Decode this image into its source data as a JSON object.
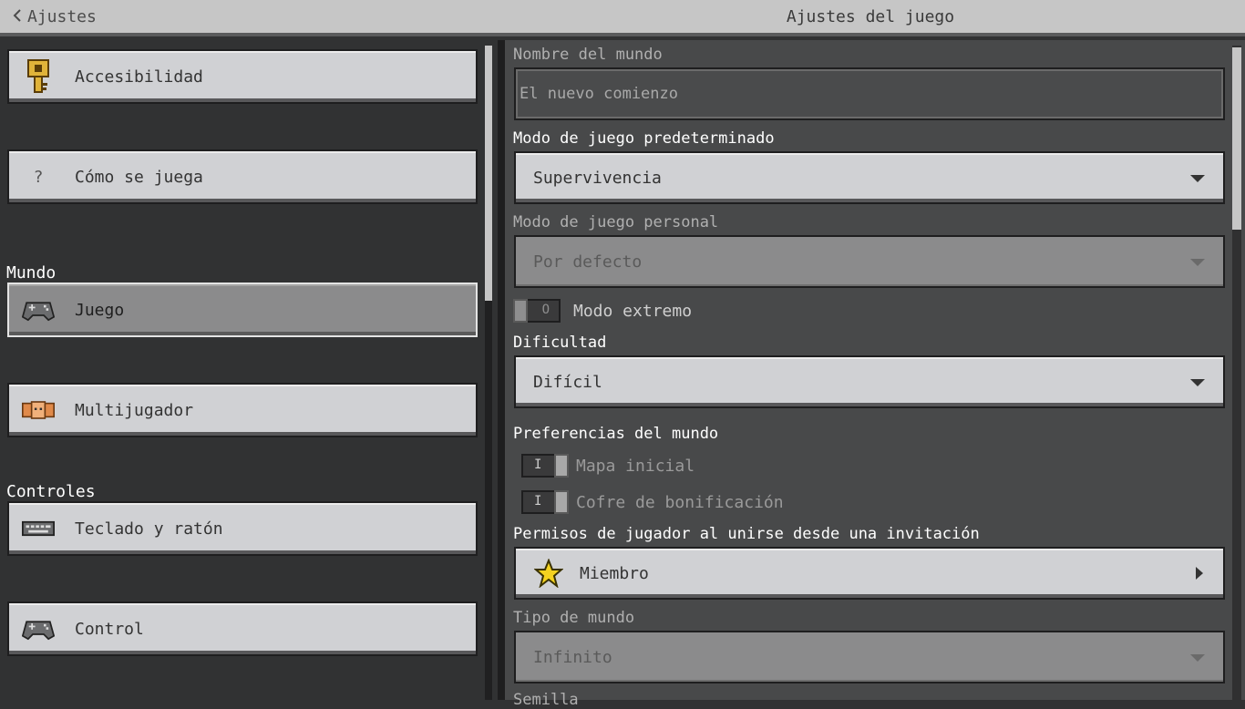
{
  "header": {
    "back_label": "Ajustes",
    "title": "Ajustes del juego"
  },
  "sidebar": {
    "items": [
      {
        "label": "Accesibilidad",
        "icon": "key-icon"
      },
      {
        "label": "Cómo se juega",
        "icon": "question-icon",
        "glyph": "?"
      },
      {
        "label": "Juego",
        "icon": "gamepad-icon",
        "active": true
      },
      {
        "label": "Multijugador",
        "icon": "players-icon"
      },
      {
        "label": "Teclado y ratón",
        "icon": "keyboard-icon"
      },
      {
        "label": "Control",
        "icon": "gamepad-icon"
      }
    ],
    "sections": {
      "world": "Mundo",
      "controls": "Controles"
    }
  },
  "settings": {
    "world_name": {
      "label": "Nombre del mundo",
      "value": "El nuevo comienzo"
    },
    "default_game_mode": {
      "label": "Modo de juego predeterminado",
      "value": "Supervivencia"
    },
    "personal_game_mode": {
      "label": "Modo de juego personal",
      "value": "Por defecto"
    },
    "hardcore": {
      "label": "Modo extremo",
      "glyph": "O"
    },
    "difficulty": {
      "label": "Dificultad",
      "value": "Difícil"
    },
    "world_prefs": {
      "label": "Preferencias del mundo"
    },
    "starter_map": {
      "label": "Mapa inicial",
      "glyph": "I"
    },
    "bonus_chest": {
      "label": "Cofre de bonificación",
      "glyph": "I"
    },
    "invite_permissions": {
      "label": "Permisos de jugador al unirse desde una invitación",
      "value": "Miembro"
    },
    "world_type": {
      "label": "Tipo de mundo",
      "value": "Infinito"
    },
    "seed": {
      "label": "Semilla"
    }
  },
  "colors": {
    "background": "#313233",
    "panel": "#48494a",
    "button": "#d0d1d4",
    "accent_star": "#f4d21f"
  }
}
